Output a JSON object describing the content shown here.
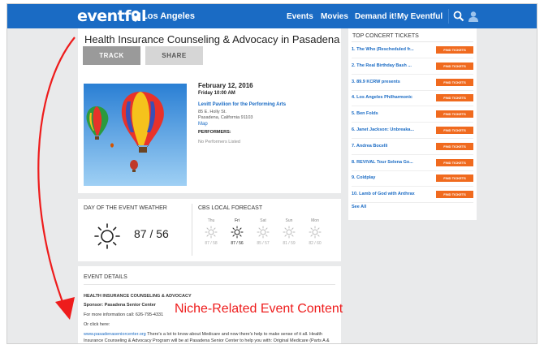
{
  "nav": {
    "logo": "eventful",
    "city": "Los Angeles",
    "links": [
      "Events",
      "Movies",
      "Demand it!",
      "My Eventful"
    ]
  },
  "event": {
    "title": "Health Insurance Counseling & Advocacy in Pasadena",
    "track_label": "TRACK",
    "share_label": "SHARE",
    "date": "February 12, 2016",
    "time": "Friday  10:00 AM",
    "venue": "Levitt Pavilion for the Performing Arts",
    "address1": "85 E. Holly St.",
    "address2": "Pasadena, California 91103",
    "map_link": "Map",
    "performers_label": "PERFORMERS:",
    "performers_value": "No Performers Listed"
  },
  "weather": {
    "heading": "DAY OF THE EVENT WEATHER",
    "temp": "87 / 56",
    "forecast_heading": "CBS LOCAL FORECAST",
    "days": [
      {
        "day": "Thu",
        "temps": "87 / 58",
        "active": false
      },
      {
        "day": "Fri",
        "temps": "87 / 56",
        "active": true
      },
      {
        "day": "Sat",
        "temps": "85 / 57",
        "active": false
      },
      {
        "day": "Sun",
        "temps": "81 / 59",
        "active": false
      },
      {
        "day": "Mon",
        "temps": "82 / 60",
        "active": false
      }
    ]
  },
  "details": {
    "heading": "EVENT DETAILS",
    "event_name": "HEALTH INSURANCE COUNSELING & ADVOCACY",
    "sponsor": "Sponsor: Pasadena Senior Center",
    "info": "For more information call: 626-795-4331",
    "click": "Or click here:",
    "link": "www.pasadenaseniorcenter.org",
    "body1": " There's a lot to know about Medicare and now there's help to make sense of it all. Health",
    "body2": "Insurance Counseling & Advocacy Program will be at Pasadena Senior Center to help you with: Original Medicare (Parts A &"
  },
  "tickets": {
    "heading": "TOP CONCERT TICKETS",
    "button_label": "FIND TICKETS",
    "items": [
      "1. The Who (Rescheduled fr...",
      "2. The Real Birthday Bash ...",
      "3. 89.9 KCRW presents",
      "4. Los Angeles Philharmonic",
      "5. Ben Folds",
      "6. Janet Jackson: Unbreaka...",
      "7. Andrea Bocelli",
      "8. REVIVAL Tour Selena Go...",
      "9. Coldplay",
      "10. Lamb of God with Anthrax"
    ],
    "see_all": "See All"
  },
  "annotation": {
    "caption": "Niche-Related Event Content"
  },
  "colors": {
    "brand_blue": "#1a6bc4",
    "ticket_orange": "#f06a1e",
    "annotation_red": "#ee1c1c"
  }
}
